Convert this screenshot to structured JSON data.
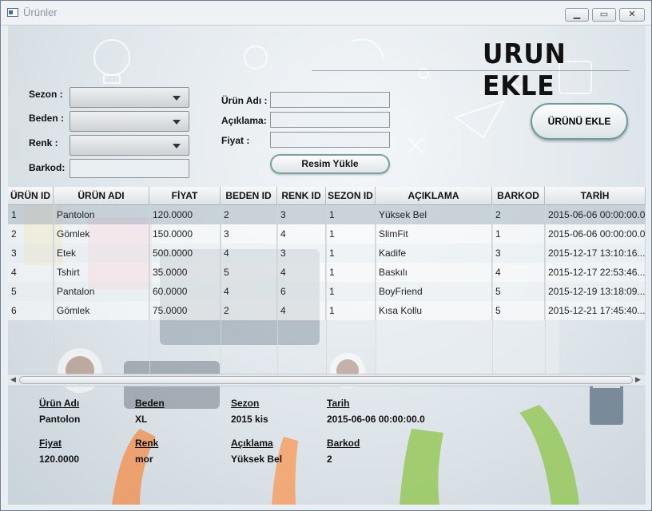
{
  "window": {
    "title": "Ürünler",
    "min_glyph": "▁",
    "max_glyph": "▭",
    "close_glyph": "✕"
  },
  "header": {
    "title": "URUN EKLE"
  },
  "form": {
    "sezon_label": "Sezon :",
    "beden_label": "Beden :",
    "renk_label": "Renk :",
    "barkod_label": "Barkod:",
    "urun_adi_label": "Ürün Adı :",
    "aciklama_label": "Açıklama:",
    "fiyat_label": "Fiyat :",
    "resim_button": "Resim Yükle",
    "add_button": "ÜRÜNÜ EKLE"
  },
  "table": {
    "columns": [
      "ÜRÜN ID",
      "ÜRÜN ADI",
      "FİYAT",
      "BEDEN ID",
      "RENK ID",
      "SEZON ID",
      "AÇIKLAMA",
      "BARKOD",
      "TARİH"
    ],
    "rows": [
      [
        "1",
        "Pantolon",
        "120.0000",
        "2",
        "3",
        "1",
        "Yüksek Bel",
        "2",
        "2015-06-06 00:00:00.0"
      ],
      [
        "2",
        "Gömlek",
        "150.0000",
        "3",
        "4",
        "1",
        "SlimFit",
        "1",
        "2015-06-06 00:00:00.0"
      ],
      [
        "3",
        "Etek",
        "500.0000",
        "4",
        "3",
        "1",
        "Kadife",
        "3",
        "2015-12-17 13:10:16..."
      ],
      [
        "4",
        "Tshirt",
        "35.0000",
        "5",
        "4",
        "1",
        "Baskılı",
        "4",
        "2015-12-17 22:53:46..."
      ],
      [
        "5",
        "Pantalon",
        "60.0000",
        "4",
        "6",
        "1",
        "BoyFriend",
        "5",
        "2015-12-19 13:18:09..."
      ],
      [
        "6",
        "Gömlek",
        "75.0000",
        "2",
        "4",
        "1",
        "Kısa Kollu",
        "5",
        "2015-12-21 17:45:40..."
      ]
    ]
  },
  "details": {
    "urun_adi_label": "Ürün Adı",
    "urun_adi_value": "Pantolon",
    "beden_label": "Beden",
    "beden_value": "XL",
    "sezon_label": "Sezon",
    "sezon_value": "2015 kis",
    "tarih_label": "Tarih",
    "tarih_value": "2015-06-06 00:00:00.0",
    "fiyat_label": "Fiyat",
    "fiyat_value": "120.0000",
    "renk_label": "Renk",
    "renk_value": "mor",
    "aciklama_label": "Açıklama",
    "aciklama_value": "Yüksek Bel",
    "barkod_label": "Barkod",
    "barkod_value": "2"
  }
}
